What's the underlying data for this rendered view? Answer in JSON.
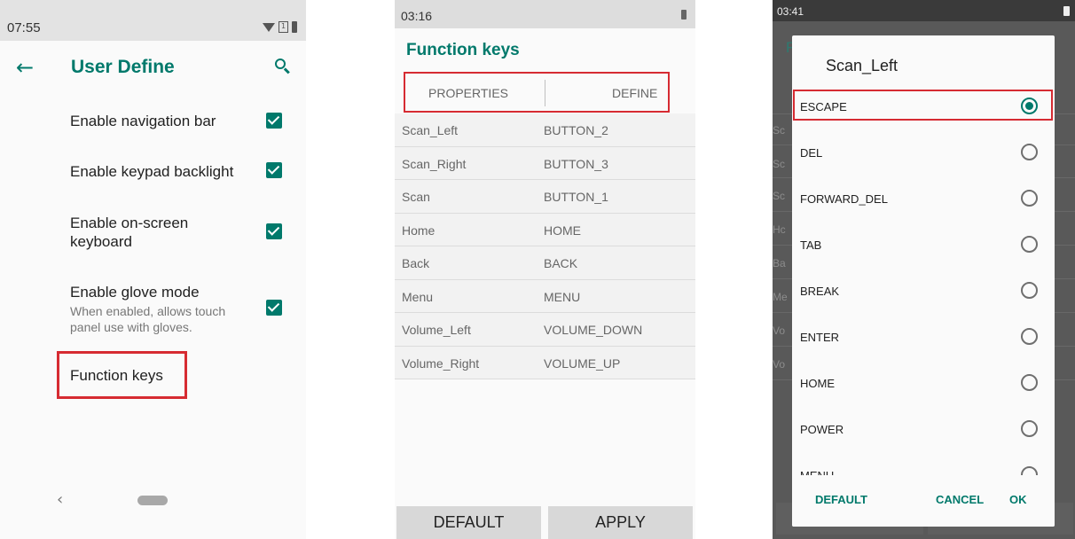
{
  "screen1": {
    "status_time": "07:55",
    "sim_label": "1",
    "app_bar_title": "User Define",
    "settings": [
      {
        "title": "Enable navigation bar",
        "checked": true
      },
      {
        "title": "Enable keypad backlight",
        "checked": true
      },
      {
        "title": "Enable on-screen\nkeyboard",
        "checked": true
      },
      {
        "title": "Enable glove mode",
        "summary": "When enabled, allows touch\npanel use with gloves.",
        "checked": true
      }
    ],
    "function_keys_label": "Function keys",
    "nav_back_glyph": "‹"
  },
  "screen2": {
    "status_time": "03:16",
    "title": "Function keys",
    "tabs": [
      "PROPERTIES",
      "DEFINE"
    ],
    "rows": [
      {
        "key": "Scan_Left",
        "value": "BUTTON_2"
      },
      {
        "key": "Scan_Right",
        "value": "BUTTON_3"
      },
      {
        "key": "Scan",
        "value": "BUTTON_1"
      },
      {
        "key": "Home",
        "value": "HOME"
      },
      {
        "key": "Back",
        "value": "BACK"
      },
      {
        "key": "Menu",
        "value": "MENU"
      },
      {
        "key": "Volume_Left",
        "value": "VOLUME_DOWN"
      },
      {
        "key": "Volume_Right",
        "value": "VOLUME_UP"
      }
    ],
    "default_button": "DEFAULT",
    "apply_button": "APPLY"
  },
  "screen3": {
    "status_time": "03:41",
    "background_fragments": [
      "F",
      "Sc",
      "Sc",
      "Sc",
      "Hc",
      "Ba",
      "Me",
      "Vo",
      "Vo"
    ],
    "dialog_title": "Scan_Left",
    "options": [
      {
        "label": "ESCAPE",
        "selected": true
      },
      {
        "label": "DEL",
        "selected": false
      },
      {
        "label": "FORWARD_DEL",
        "selected": false
      },
      {
        "label": "TAB",
        "selected": false
      },
      {
        "label": "BREAK",
        "selected": false
      },
      {
        "label": "ENTER",
        "selected": false
      },
      {
        "label": "HOME",
        "selected": false
      },
      {
        "label": "POWER",
        "selected": false
      },
      {
        "label": "MENU",
        "selected": false
      }
    ],
    "actions": {
      "default": "DEFAULT",
      "cancel": "CANCEL",
      "ok": "OK"
    }
  },
  "colors": {
    "accent": "#00796b",
    "highlight_box": "#d62b32"
  }
}
